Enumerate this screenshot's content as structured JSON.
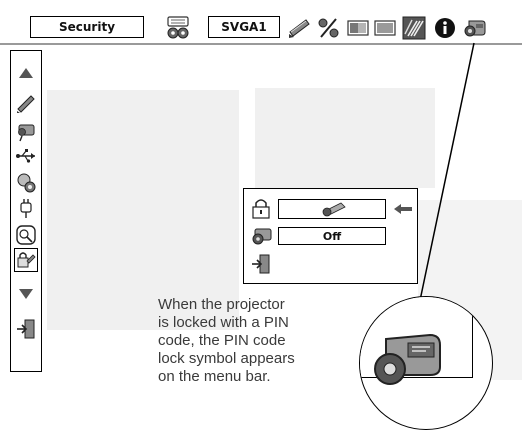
{
  "menubar": {
    "security_label": "Security",
    "signal_label": "SVGA1"
  },
  "dialog": {
    "pin_status": "Off"
  },
  "caption": "When the projector\nis locked with a PIN\ncode, the PIN code\nlock symbol appears\non the menu bar."
}
